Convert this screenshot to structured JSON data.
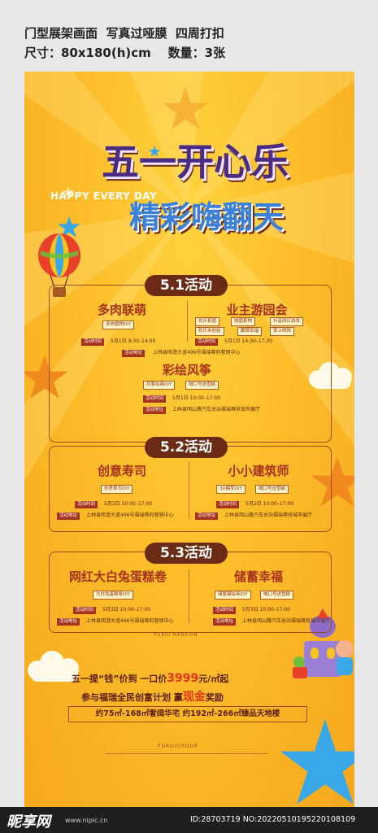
{
  "spec": {
    "line1": "门型展架画面  写真过哑膜  四周打扣",
    "line2": "尺寸：80x180(h)cm    数量：3张"
  },
  "headline": {
    "title": "五一开心乐",
    "subtitle_en": "HAPPY EVERY DAY",
    "title2": "精彩嗨翻天"
  },
  "sections": [
    {
      "label": "5.1活动",
      "activities": [
        {
          "title": "多肉联萌",
          "chips": [
            "多肉植物DIY"
          ],
          "time_tag": "活动时间",
          "time": "5月1日 9:30–14:00",
          "place_tag": "活动地址",
          "place": "上林县明澄大道496号福瑞尊府营销中心"
        },
        {
          "title": "业主游园会",
          "chips": [
            "欢乐套圈",
            "抛圈套物",
            "抖音网红游戏",
            "欢乐夹娃娃",
            "翻牌幸福",
            "掌上明珠"
          ],
          "time_tag": "活动时间",
          "time": "5月1日 14:30–17:30"
        },
        {
          "title": "彩绘风筝",
          "chips": [
            "风筝绘画DIY",
            "喊口号送雪糕"
          ],
          "time_tag": "活动时间",
          "time": "5月1日 10:00–17:00",
          "place_tag": "活动地址",
          "place": "上林县明山路汽车总站福瑞尊府城市展厅"
        }
      ]
    },
    {
      "label": "5.2活动",
      "activities": [
        {
          "title": "创意寿司",
          "chips": [
            "创意寿司DIY"
          ],
          "time_tag": "活动时间",
          "time": "5月2日 10:00–17:00",
          "place_tag": "活动地址",
          "place": "上林县明澄大道496号福瑞尊府营销中心"
        },
        {
          "title": "小小建筑师",
          "chips": [
            "3D模型DIY",
            "喊口号送雪糕"
          ],
          "time_tag": "活动时间",
          "time": "5月2日 10:00–17:00",
          "place_tag": "活动地址",
          "place": "上林县明山路汽车总站福瑞尊府城市展厅"
        }
      ]
    },
    {
      "label": "5.3活动",
      "activities": [
        {
          "title": "网红大白兔蛋糕卷",
          "chips": [
            "大白兔蛋糕卷DIY"
          ],
          "time_tag": "活动时间",
          "time": "5月3日 10:00–17:00",
          "place_tag": "活动地址",
          "place": "上林县明澄大道496号福瑞尊府营销中心"
        },
        {
          "title": "储蓄幸福",
          "chips": [
            "储蓄罐绘画DIY",
            "喊口号送雪糕"
          ],
          "time_tag": "活动时间",
          "time": "5月3日 10:00–17:00",
          "place_tag": "活动地址",
          "place": "上林县明山路汽车总站福瑞尊府城市展厅"
        }
      ]
    }
  ],
  "brand_en": "FURUI MANSION",
  "promo": {
    "line1a": "五一提“钱”价到  一口价",
    "price": "3999",
    "line1b": "元/㎡起",
    "line2a": "参与福瑞全民创富计划  赢",
    "line2hl": "现金",
    "line2b": "奖励",
    "bar": "约75㎡-168㎡奢阔华宅  约192㎡-266㎡臻品天地楼"
  },
  "group_en": "FURUIGROUP",
  "watermark": {
    "logo": "昵享网",
    "url": "www.nipic.cn",
    "id": "ID:28703719 NO:20220510195220108109"
  },
  "colors": {
    "bg": "#fdbd2a",
    "title": "#4a2c83",
    "accent": "#a6321b",
    "star_blue": "#3aa8e8",
    "star_orange": "#f08a1c"
  }
}
